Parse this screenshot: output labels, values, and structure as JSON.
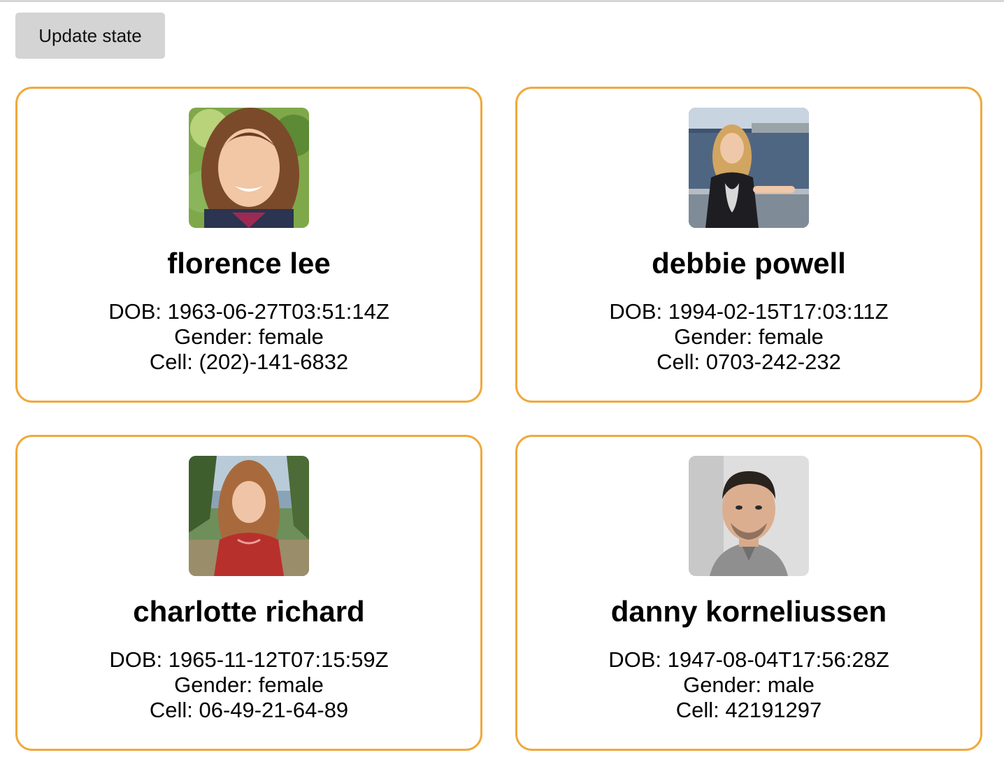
{
  "toolbar": {
    "update_label": "Update state"
  },
  "labels": {
    "dob": "DOB:",
    "gender": "Gender:",
    "cell": "Cell:"
  },
  "users": [
    {
      "name": "florence lee",
      "dob": "1963-06-27T03:51:14Z",
      "gender": "female",
      "cell": "(202)-141-6832"
    },
    {
      "name": "debbie powell",
      "dob": "1994-02-15T17:03:11Z",
      "gender": "female",
      "cell": "0703-242-232"
    },
    {
      "name": "charlotte richard",
      "dob": "1965-11-12T07:15:59Z",
      "gender": "female",
      "cell": "06-49-21-64-89"
    },
    {
      "name": "danny korneliussen",
      "dob": "1947-08-04T17:56:28Z",
      "gender": "male",
      "cell": "42191297"
    }
  ],
  "colors": {
    "card_border": "#f0a93c",
    "button_bg": "#d4d4d4"
  }
}
